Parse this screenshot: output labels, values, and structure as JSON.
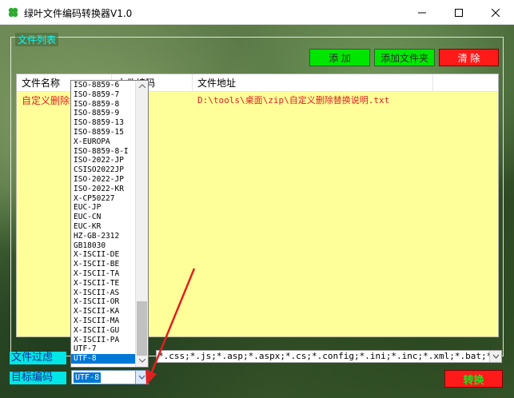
{
  "window": {
    "title": "绿叶文件编码转换器V1.0"
  },
  "group": {
    "legend": "文件列表"
  },
  "buttons": {
    "add": "添 加",
    "add_folder": "添加文件夹",
    "clear": "清 除",
    "convert": "转换"
  },
  "list": {
    "columns": [
      "文件名称",
      "文件编码",
      "文件地址"
    ],
    "rows": [
      {
        "name": "自定义删除替换说明.txt",
        "encoding": "",
        "path": "D:\\tools\\桌面\\zip\\自定义删除替换说明.txt"
      }
    ]
  },
  "filter": {
    "label": "文件过虑",
    "value": "*.css;*.js;*.asp;*.aspx;*.cs;*.config;*.ini;*.inc;*.xml;*.bat;*.vb;*.php;*.jsp;*.java"
  },
  "target": {
    "label": "目标编码",
    "value": "UTF-8"
  },
  "encodings": {
    "options": [
      "ISO-8859-6",
      "ISO-8859-7",
      "ISO-8859-8",
      "ISO-8859-9",
      "ISO-8859-13",
      "ISO-8859-15",
      "X-EUROPA",
      "ISO-8859-8-I",
      "ISO-2022-JP",
      "CSISO2022JP",
      "ISO-2022-JP",
      "ISO-2022-KR",
      "X-CP50227",
      "EUC-JP",
      "EUC-CN",
      "EUC-KR",
      "HZ-GB-2312",
      "GB18030",
      "X-ISCII-DE",
      "X-ISCII-BE",
      "X-ISCII-TA",
      "X-ISCII-TE",
      "X-ISCII-AS",
      "X-ISCII-OR",
      "X-ISCII-KA",
      "X-ISCII-MA",
      "X-ISCII-GU",
      "X-ISCII-PA",
      "UTF-7",
      "UTF-8"
    ],
    "selected_index": 29
  },
  "colors": {
    "accent_green": "#00e600",
    "accent_red": "#ff1a1a",
    "list_bg": "#ffff99",
    "label_cyan": "#00e5e5",
    "annotation_arrow": "#e02020"
  }
}
